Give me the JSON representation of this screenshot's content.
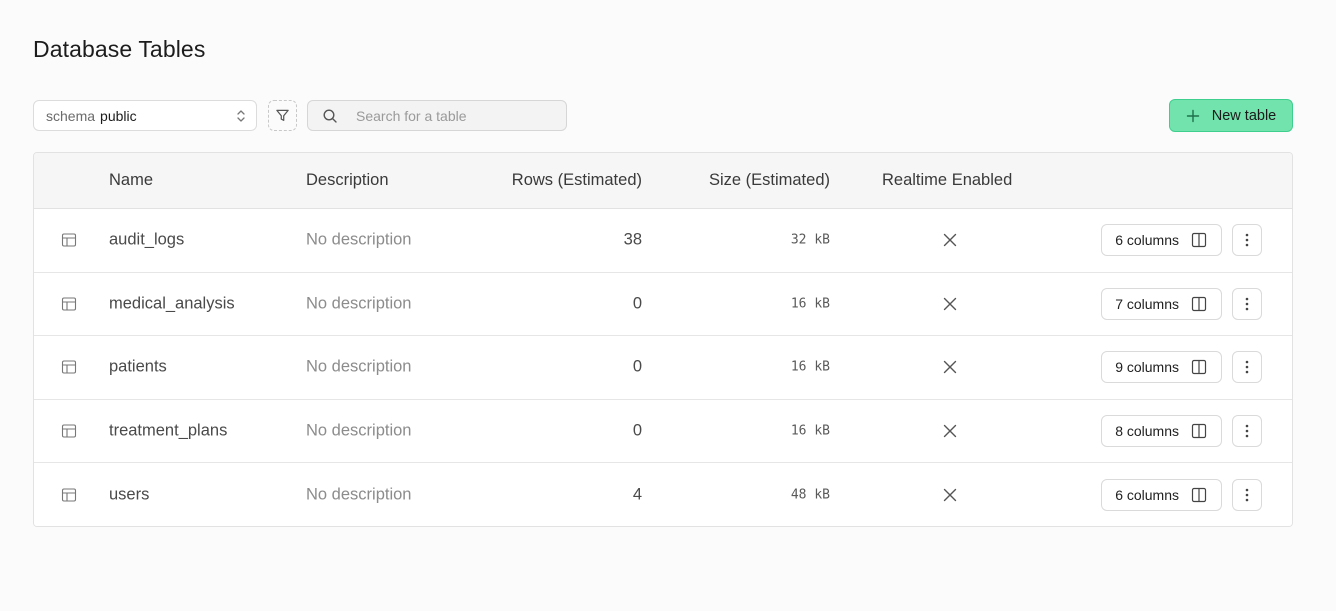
{
  "page": {
    "title": "Database Tables"
  },
  "toolbar": {
    "schema_label": "schema",
    "schema_value": "public",
    "search_placeholder": "Search for a table",
    "new_table_label": "New table"
  },
  "table": {
    "headers": [
      "Name",
      "Description",
      "Rows (Estimated)",
      "Size (Estimated)",
      "Realtime Enabled"
    ],
    "rows": [
      {
        "name": "audit_logs",
        "description": "No description",
        "rows": "38",
        "size": "32 kB",
        "realtime": "x-icon",
        "columns": "6 columns"
      },
      {
        "name": "medical_analysis",
        "description": "No description",
        "rows": "0",
        "size": "16 kB",
        "realtime": "x-icon",
        "columns": "7 columns"
      },
      {
        "name": "patients",
        "description": "No description",
        "rows": "0",
        "size": "16 kB",
        "realtime": "x-icon",
        "columns": "9 columns"
      },
      {
        "name": "treatment_plans",
        "description": "No description",
        "rows": "0",
        "size": "16 kB",
        "realtime": "x-icon",
        "columns": "8 columns"
      },
      {
        "name": "users",
        "description": "No description",
        "rows": "4",
        "size": "48 kB",
        "realtime": "x-icon",
        "columns": "6 columns"
      }
    ]
  },
  "colors": {
    "accent": "#72e3ad",
    "accent_border": "#3ecf8e",
    "background": "#fbfbfb"
  }
}
